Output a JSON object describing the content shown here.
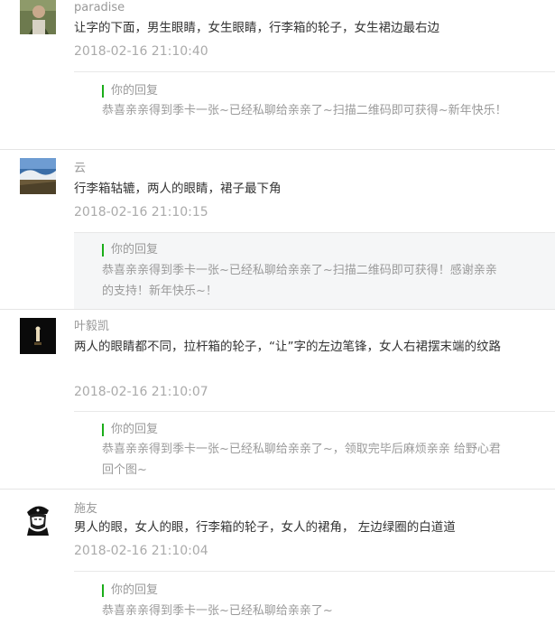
{
  "comments": [
    {
      "nickname": "paradise",
      "content": "让字的下面，男生眼睛，女生眼睛，行李箱的轮子，女生裙边最右边",
      "time": "2018-02-16 21:10:40",
      "reply_label": "你的回复",
      "reply_text": "恭喜亲亲得到季卡一张~已经私聊给亲亲了~扫描二维码即可获得~新年快乐！"
    },
    {
      "nickname": "云",
      "content": "行李箱轱辘，两人的眼睛，裙子最下角",
      "time": "2018-02-16 21:10:15",
      "reply_label": "你的回复",
      "reply_text": "恭喜亲亲得到季卡一张~已经私聊给亲亲了~扫描二维码即可获得！感谢亲亲的支持！新年快乐~！"
    },
    {
      "nickname": "叶毅凯",
      "content": "两人的眼睛都不同，拉杆箱的轮子，“让”字的左边笔锋，女人右裙摆末端的纹路",
      "time": "2018-02-16 21:10:07",
      "reply_label": "你的回复",
      "reply_text": "恭喜亲亲得到季卡一张~已经私聊给亲亲了~，领取完毕后麻烦亲亲 给野心君回个图~"
    },
    {
      "nickname": "施友",
      "content": "男人的眼，女人的眼，行李箱的轮子，女人的裙角， 左边绿圈的白道道",
      "time": "2018-02-16 21:10:04",
      "reply_label": "你的回复",
      "reply_text": "恭喜亲亲得到季卡一张~已经私聊给亲亲了~"
    }
  ],
  "colors": {
    "accent": "#1aad19",
    "meta_text": "#aaaaaa",
    "body_text": "#333333",
    "reply_bg": "#f5f6f7"
  }
}
